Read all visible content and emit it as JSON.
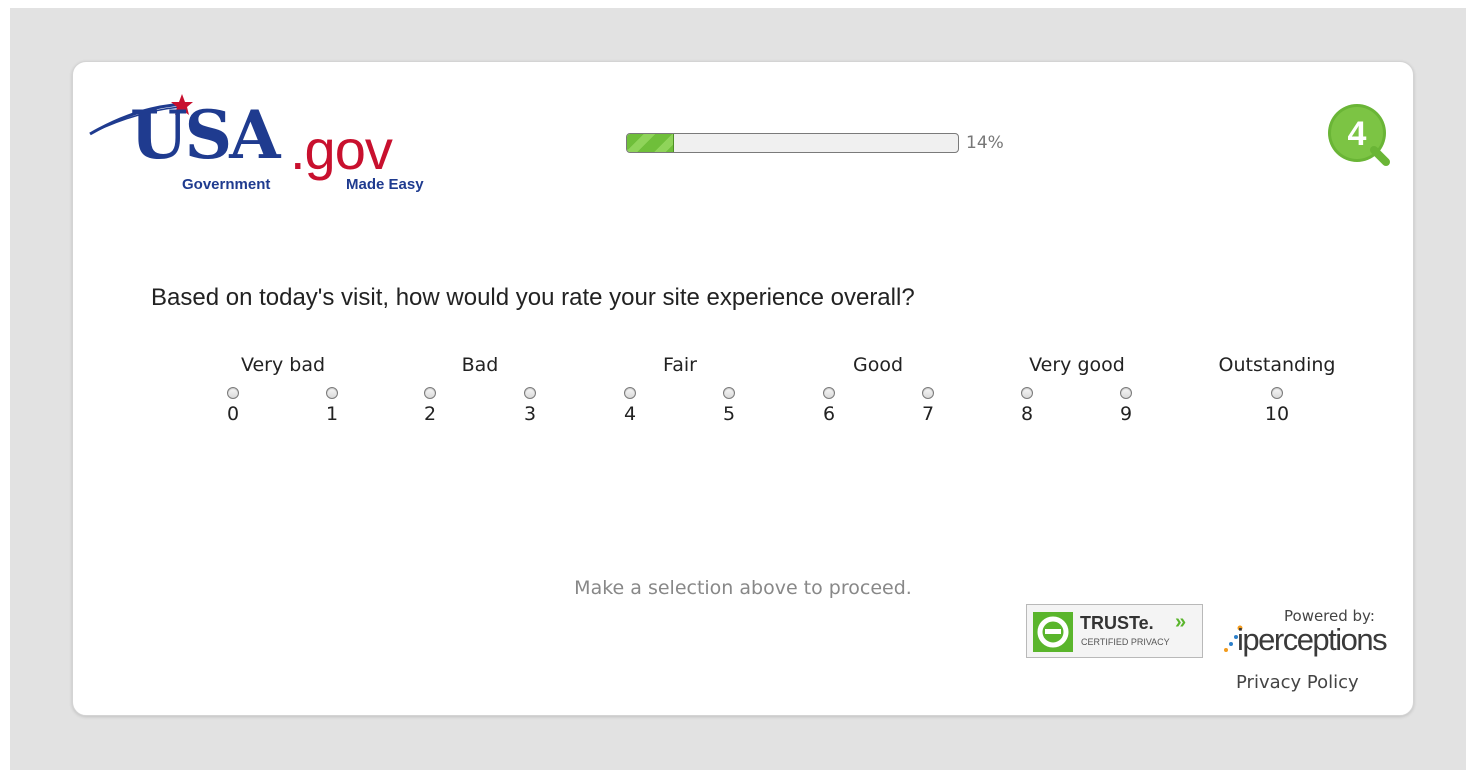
{
  "logo": {
    "main": "USA",
    "domain": ".gov",
    "tagline_left": "Government",
    "tagline_right": "Made Easy",
    "icon": "usa-gov-star-swoosh-icon"
  },
  "progress": {
    "percent": 14,
    "label": "14%"
  },
  "badge": {
    "label": "4",
    "icon": "4q-logo-icon",
    "color": "#6ab536"
  },
  "question": {
    "text": "Based on today's visit, how would you rate your site experience overall?",
    "scale_labels": [
      "Very bad",
      "Bad",
      "Fair",
      "Good",
      "Very good",
      "Outstanding"
    ],
    "options": [
      "0",
      "1",
      "2",
      "3",
      "4",
      "5",
      "6",
      "7",
      "8",
      "9",
      "10"
    ],
    "selected": null
  },
  "hint": "Make a selection above to proceed.",
  "truste": {
    "name": "TRUSTe.",
    "arrows": "»",
    "subtitle": "CERTIFIED PRIVACY",
    "icon": "truste-seal-icon",
    "color": "#5ab52c"
  },
  "powered_by": {
    "label": "Powered by:",
    "brand": "iperceptions",
    "icon": "iperceptions-dots-icon"
  },
  "footer": {
    "privacy_link": "Privacy Policy"
  }
}
